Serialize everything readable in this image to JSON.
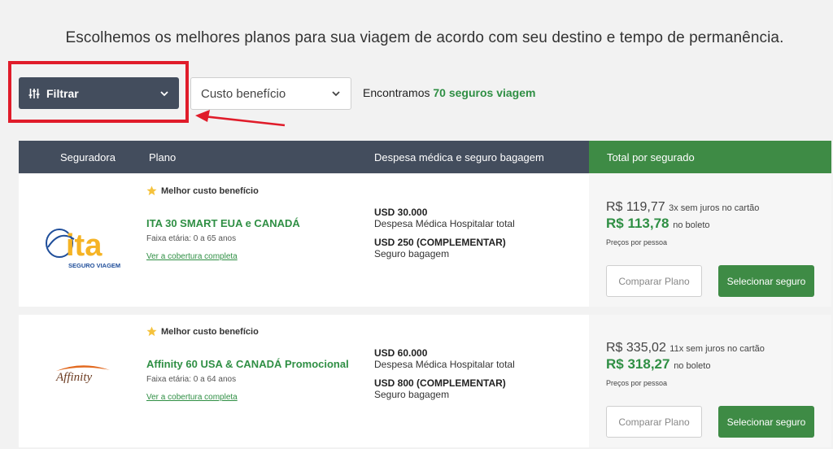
{
  "headline": "Escolhemos os melhores planos para sua viagem de acordo com seu destino e tempo de permanência.",
  "filter": {
    "label": "Filtrar"
  },
  "sort": {
    "selected": "Custo benefício"
  },
  "found": {
    "prefix": "Encontramos",
    "highlight": "70 seguros viagem"
  },
  "table_header": {
    "insurer": "Seguradora",
    "plan": "Plano",
    "coverage": "Despesa médica e seguro bagagem",
    "total": "Total por segurado"
  },
  "plans": [
    {
      "logo_text": "ita",
      "logo_subtext": "SEGURO VIAGEM",
      "badge": "Melhor custo benefício",
      "name": "ITA 30 SMART EUA e CANADÁ",
      "age_range": "Faixa etária: 0 a 65 anos",
      "coverage_link": "Ver a cobertura completa",
      "medical_amount": "USD 30.000",
      "medical_label": "Despesa Médica Hospitalar total",
      "baggage_amount": "USD 250 (COMPLEMENTAR)",
      "baggage_label": "Seguro bagagem",
      "price_card": "R$ 119,77",
      "price_card_note": "3x sem juros no cartão",
      "price_boleto": "R$ 113,78",
      "price_boleto_note": "no boleto",
      "per_person": "Preços por pessoa",
      "compare_label": "Comparar Plano",
      "select_label": "Selecionar seguro"
    },
    {
      "logo_text": "Affinity",
      "logo_subtext": "",
      "badge": "Melhor custo benefício",
      "name": "Affinity 60 USA & CANADÁ Promocional",
      "age_range": "Faixa etária: 0 a 64 anos",
      "coverage_link": "Ver a cobertura completa",
      "medical_amount": "USD 60.000",
      "medical_label": "Despesa Médica Hospitalar total",
      "baggage_amount": "USD 800 (COMPLEMENTAR)",
      "baggage_label": "Seguro bagagem",
      "price_card": "R$ 335,02",
      "price_card_note": "11x sem juros no cartão",
      "price_boleto": "R$ 318,27",
      "price_boleto_note": "no boleto",
      "per_person": "Preços por pessoa",
      "compare_label": "Comparar Plano",
      "select_label": "Selecionar seguro"
    }
  ],
  "colors": {
    "dark_header": "#434d5d",
    "green_accent": "#3e8b45",
    "highlight_red": "#e01c2a",
    "ita_yellow": "#f5b324",
    "ita_blue": "#1f4e9a"
  }
}
